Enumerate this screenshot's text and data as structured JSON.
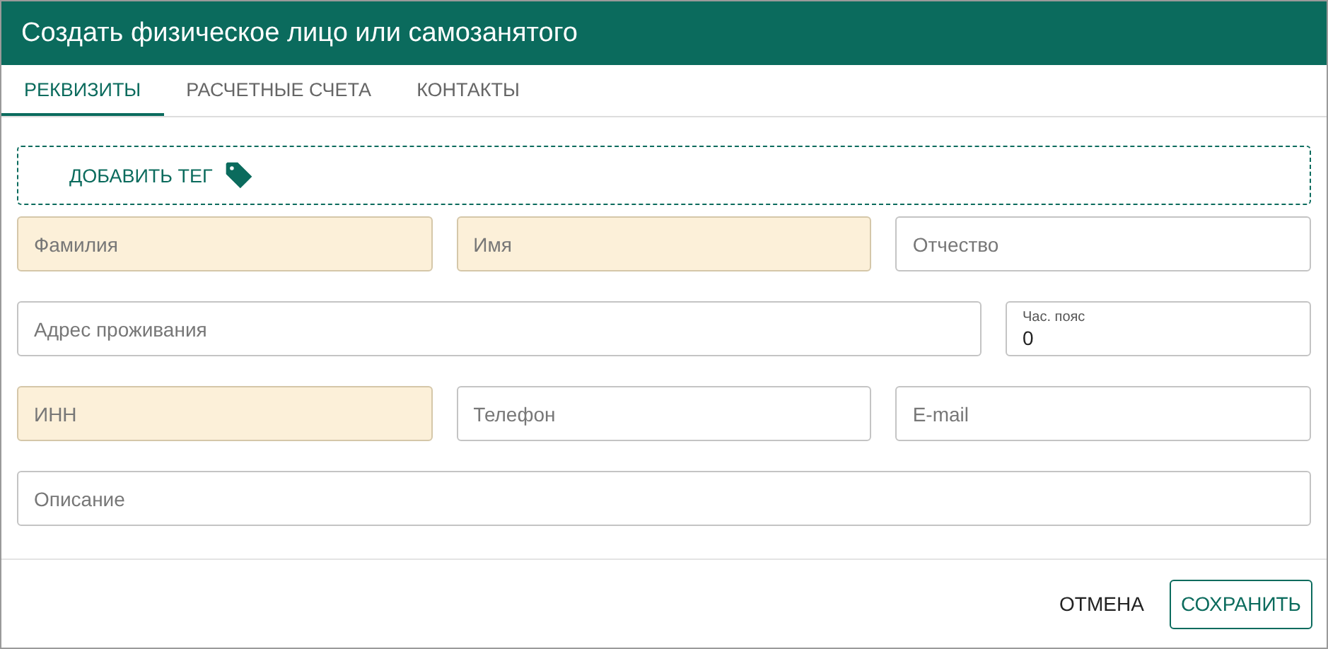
{
  "window": {
    "title": "Создать физическое лицо или самозанятого"
  },
  "tabs": [
    {
      "label": "РЕКВИЗИТЫ",
      "selected": true
    },
    {
      "label": "РАСЧЕТНЫЕ СЧЕТА",
      "selected": false
    },
    {
      "label": "КОНТАКТЫ",
      "selected": false
    }
  ],
  "tag_button": {
    "label": "ДОБАВИТЬ ТЕГ"
  },
  "rows": [
    [
      {
        "kind": "input",
        "placeholder": "Фамилия",
        "required": true
      },
      {
        "kind": "input",
        "placeholder": "Имя",
        "required": true
      },
      {
        "kind": "input",
        "placeholder": "Отчество",
        "required": false
      }
    ],
    [
      {
        "kind": "input",
        "placeholder": "Адрес проживания",
        "required": false
      },
      {
        "kind": "labeled",
        "label": "Час. пояс",
        "value": "0",
        "required": false
      }
    ],
    [
      {
        "kind": "input",
        "placeholder": "ИНН",
        "required": true
      },
      {
        "kind": "input",
        "placeholder": "Телефон",
        "required": false
      },
      {
        "kind": "input",
        "placeholder": "E-mail",
        "required": false
      }
    ],
    [
      {
        "kind": "input",
        "placeholder": "Описание",
        "required": false
      }
    ]
  ],
  "buttons": [
    {
      "label": "ОТМЕНА",
      "kind": "text"
    },
    {
      "label": "СОХРАНИТЬ",
      "kind": "outlined"
    }
  ]
}
